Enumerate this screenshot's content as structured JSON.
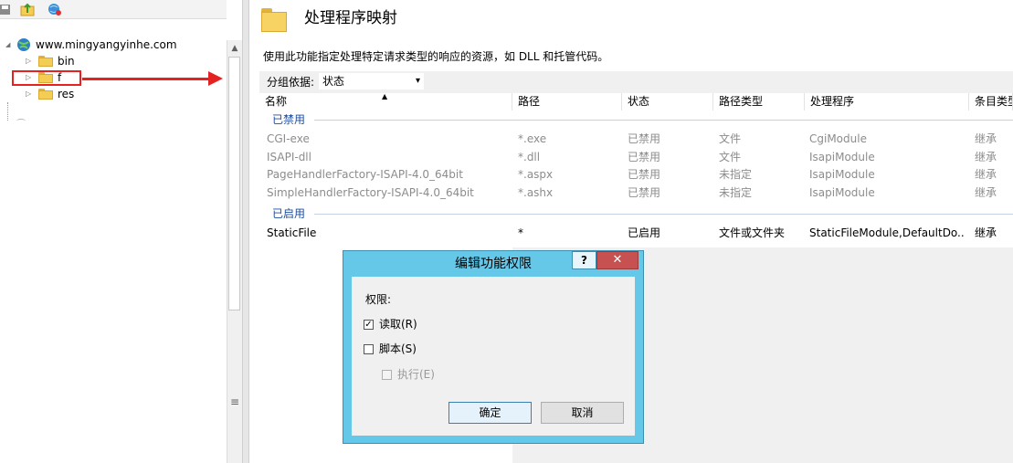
{
  "tree": {
    "site": "www.mingyangyinhe.com",
    "items": [
      {
        "label": "bin"
      },
      {
        "label": "f"
      },
      {
        "label": "res"
      }
    ]
  },
  "feature": {
    "title": "处理程序映射",
    "description": "使用此功能指定处理特定请求类型的响应的资源，如 DLL 和托管代码。",
    "group_by_label": "分组依据:",
    "group_by_value": "状态"
  },
  "grid": {
    "columns": [
      "名称",
      "路径",
      "状态",
      "路径类型",
      "处理程序",
      "条目类型"
    ],
    "groups": [
      {
        "label": "已禁用",
        "rows": [
          [
            "CGI-exe",
            "*.exe",
            "已禁用",
            "文件",
            "CgiModule",
            "继承"
          ],
          [
            "ISAPI-dll",
            "*.dll",
            "已禁用",
            "文件",
            "IsapiModule",
            "继承"
          ],
          [
            "PageHandlerFactory-ISAPI-4.0_64bit",
            "*.aspx",
            "已禁用",
            "未指定",
            "IsapiModule",
            "继承"
          ],
          [
            "SimpleHandlerFactory-ISAPI-4.0_64bit",
            "*.ashx",
            "已禁用",
            "未指定",
            "IsapiModule",
            "继承"
          ]
        ]
      },
      {
        "label": "已启用",
        "rows": [
          [
            "StaticFile",
            "*",
            "已启用",
            "文件或文件夹",
            "StaticFileModule,DefaultDo...",
            "继承"
          ]
        ]
      }
    ]
  },
  "dialog": {
    "title": "编辑功能权限",
    "help": "?",
    "close": "✕",
    "permissions_label": "权限:",
    "read_label": "读取(R)",
    "read_checked": true,
    "script_label": "脚本(S)",
    "script_checked": false,
    "execute_label": "执行(E)",
    "execute_checked": false,
    "ok_label": "确定",
    "cancel_label": "取消"
  },
  "icons": {
    "checkmark": "✓",
    "sort_up": "▲",
    "dropdown": "▾",
    "expander": "▷",
    "scroll_up": "▲",
    "grip": "≡"
  },
  "colors": {
    "dialog_frame": "#65c8e8",
    "close_button": "#c75050",
    "annotation": "#e52222",
    "group_header": "#1e4c9e"
  }
}
